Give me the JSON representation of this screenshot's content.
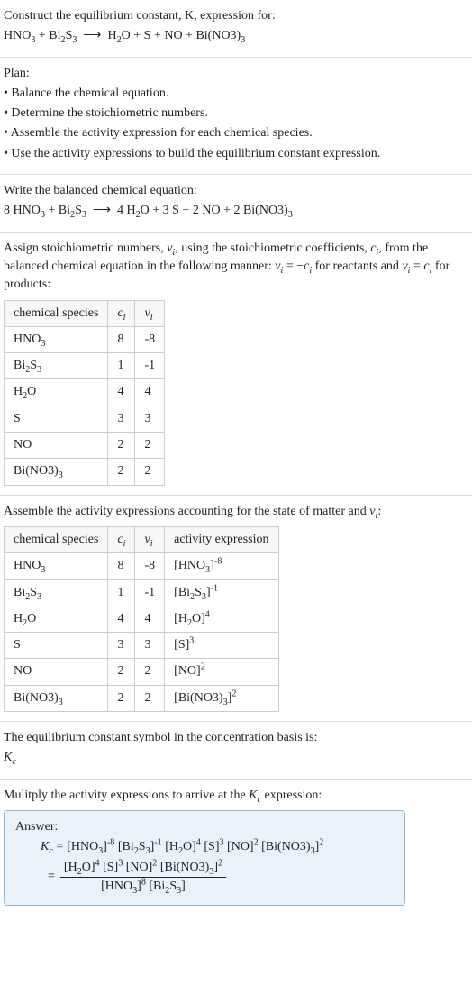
{
  "intro": {
    "line1": "Construct the equilibrium constant, K, expression for:",
    "reaction_txt": "HNO₃ + Bi₂S₃ ⟶ H₂O + S + NO + Bi(NO3)₃"
  },
  "plan": {
    "heading": "Plan:",
    "items": [
      "• Balance the chemical equation.",
      "• Determine the stoichiometric numbers.",
      "• Assemble the activity expression for each chemical species.",
      "• Use the activity expressions to build the equilibrium constant expression."
    ]
  },
  "balanced": {
    "heading": "Write the balanced chemical equation:",
    "reaction_txt": "8 HNO₃ + Bi₂S₃ ⟶ 4 H₂O + 3 S + 2 NO + 2 Bi(NO3)₃"
  },
  "stoich": {
    "para1": "Assign stoichiometric numbers, νᵢ, using the stoichiometric coefficients, cᵢ, from the balanced chemical equation in the following manner: νᵢ = −cᵢ for reactants and νᵢ = cᵢ for products:",
    "headers": {
      "sp": "chemical species",
      "c": "cᵢ",
      "v": "νᵢ"
    },
    "rows": [
      {
        "sp": "HNO₃",
        "c": "8",
        "v": "-8"
      },
      {
        "sp": "Bi₂S₃",
        "c": "1",
        "v": "-1"
      },
      {
        "sp": "H₂O",
        "c": "4",
        "v": "4"
      },
      {
        "sp": "S",
        "c": "3",
        "v": "3"
      },
      {
        "sp": "NO",
        "c": "2",
        "v": "2"
      },
      {
        "sp": "Bi(NO3)₃",
        "c": "2",
        "v": "2"
      }
    ]
  },
  "activity": {
    "heading": "Assemble the activity expressions accounting for the state of matter and νᵢ:",
    "headers": {
      "sp": "chemical species",
      "c": "cᵢ",
      "v": "νᵢ",
      "a": "activity expression"
    },
    "rows": [
      {
        "sp": "HNO₃",
        "c": "8",
        "v": "-8",
        "a": "[HNO₃]⁻⁸"
      },
      {
        "sp": "Bi₂S₃",
        "c": "1",
        "v": "-1",
        "a": "[Bi₂S₃]⁻¹"
      },
      {
        "sp": "H₂O",
        "c": "4",
        "v": "4",
        "a": "[H₂O]⁴"
      },
      {
        "sp": "S",
        "c": "3",
        "v": "3",
        "a": "[S]³"
      },
      {
        "sp": "NO",
        "c": "2",
        "v": "2",
        "a": "[NO]²"
      },
      {
        "sp": "Bi(NO3)₃",
        "c": "2",
        "v": "2",
        "a": "[Bi(NO3)₃]²"
      }
    ]
  },
  "symbol": {
    "heading": "The equilibrium constant symbol in the concentration basis is:",
    "value": "K_c"
  },
  "final": {
    "heading": "Mulitply the activity expressions to arrive at the K_c expression:",
    "answer_label": "Answer:",
    "line1_lead": "K_c =",
    "line1_expr": "[HNO₃]⁻⁸ [Bi₂S₃]⁻¹ [H₂O]⁴ [S]³ [NO]² [Bi(NO3)₃]²",
    "frac_num": "[H₂O]⁴ [S]³ [NO]² [Bi(NO3)₃]²",
    "frac_den": "[HNO₃]⁸ [Bi₂S₃]"
  }
}
